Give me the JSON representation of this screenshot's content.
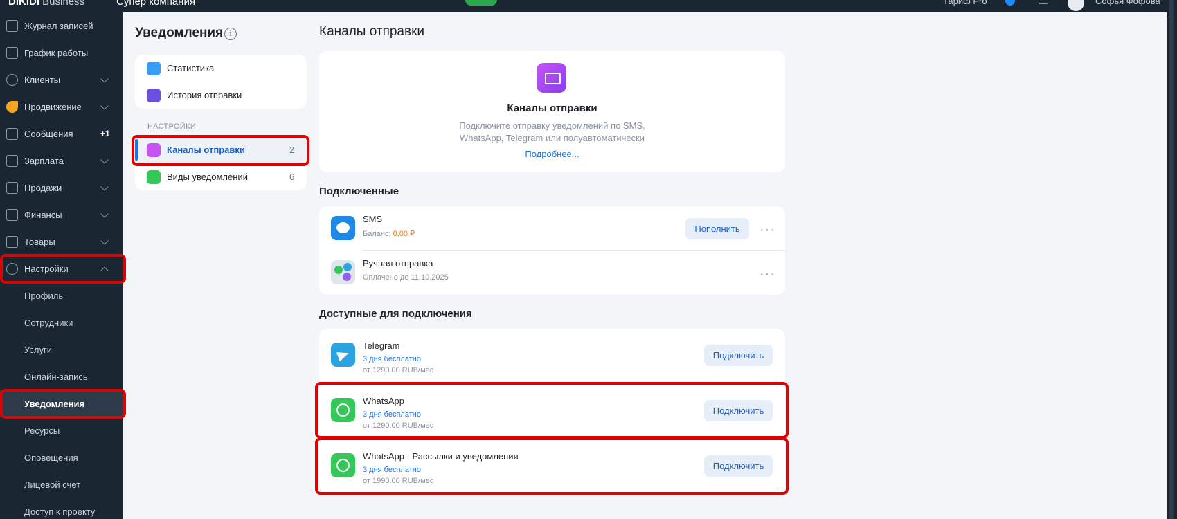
{
  "topbar": {
    "brand": "DIKIDI",
    "brand_suffix": " Business",
    "company": "Супер компания",
    "tariff": "Тариф Pro",
    "user": "Софья Фофова"
  },
  "sidebar": {
    "items": [
      {
        "label": "Журнал записей",
        "icon": "journal-icon"
      },
      {
        "label": "График работы",
        "icon": "calendar-icon"
      },
      {
        "label": "Клиенты",
        "icon": "clients-icon"
      },
      {
        "label": "Продвижение",
        "icon": "rocket-icon"
      },
      {
        "label": "Сообщения",
        "icon": "messages-icon",
        "badge": "+1"
      },
      {
        "label": "Зарплата",
        "icon": "salary-icon"
      },
      {
        "label": "Продажи",
        "icon": "sales-icon"
      },
      {
        "label": "Финансы",
        "icon": "finance-icon"
      },
      {
        "label": "Товары",
        "icon": "goods-icon"
      },
      {
        "label": "Настройки",
        "icon": "gear-icon"
      }
    ],
    "sub_items": [
      "Профиль",
      "Сотрудники",
      "Услуги",
      "Онлайн-запись",
      "Уведомления",
      "Ресурсы",
      "Оповещения",
      "Лицевой счет",
      "Доступ к проекту"
    ]
  },
  "notifications": {
    "title": "Уведомления",
    "info": "i",
    "menu": [
      {
        "label": "Статистика",
        "icon": "statistics-icon",
        "color": "#3b9cf5"
      },
      {
        "label": "История отправки",
        "icon": "history-icon",
        "color": "#6a4fe0"
      }
    ],
    "section": "НАСТРОЙКИ",
    "settings": [
      {
        "label": "Каналы отправки",
        "count": "2",
        "icon": "channels-icon",
        "color": "#c653f2"
      },
      {
        "label": "Виды уведомлений",
        "count": "6",
        "icon": "types-icon",
        "color": "#35c759"
      }
    ]
  },
  "main": {
    "title": "Каналы отправки",
    "hero": {
      "title": "Каналы отправки",
      "desc_line1": "Подключите отправку уведомлений по SMS,",
      "desc_line2": "WhatsApp, Telegram или полуавтоматически",
      "link": "Подробнее..."
    },
    "connected_title": "Подключенные",
    "connected": [
      {
        "name": "SMS",
        "sub_label": "Баланс: ",
        "sub_value": "0,00 ₽",
        "button": "Пополнить",
        "icon": "sms-icon"
      },
      {
        "name": "Ручная отправка",
        "sub_label": "Оплачено до 11.10.2025",
        "icon": "manual-send-icon"
      }
    ],
    "available_title": "Доступные для подключения",
    "available": [
      {
        "name": "Telegram",
        "trial": "3 дня бесплатно",
        "price": "от 1290.00 RUB/мес",
        "button": "Подключить",
        "icon": "telegram-icon"
      },
      {
        "name": "WhatsApp",
        "trial": "3 дня бесплатно",
        "price": "от 1290.00 RUB/мес",
        "button": "Подключить",
        "icon": "whatsapp-icon"
      },
      {
        "name": "WhatsApp - Рассылки и уведомления",
        "trial": "3 дня бесплатно",
        "price": "от 1990.00 RUB/мес",
        "button": "Подключить",
        "icon": "whatsapp-icon"
      }
    ]
  },
  "colors": {
    "sidebar_bg": "#1b2633",
    "accent": "#1a73e8",
    "highlight": "#e30000"
  }
}
